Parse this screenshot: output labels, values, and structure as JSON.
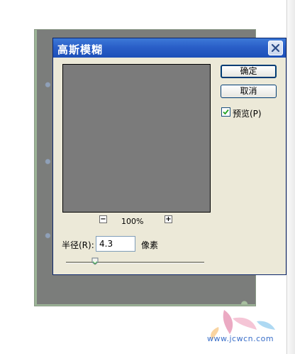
{
  "dialog": {
    "title": "高斯模糊",
    "ok_label": "确定",
    "cancel_label": "取消",
    "preview_label": "预览(P)",
    "preview_checked": true,
    "zoom": "100%",
    "zoom_out_symbol": "−",
    "zoom_in_symbol": "+",
    "radius_label": "半径(R):",
    "radius_value": "4.3",
    "radius_unit": "像素",
    "radius_slider_fraction": 0.21
  },
  "watermark": {
    "text": "www.jcwcn.com"
  },
  "colors": {
    "titlebar": "#2a5fc8",
    "dialog_bg": "#ece9d8",
    "preview_gray": "#7b7b7b"
  }
}
